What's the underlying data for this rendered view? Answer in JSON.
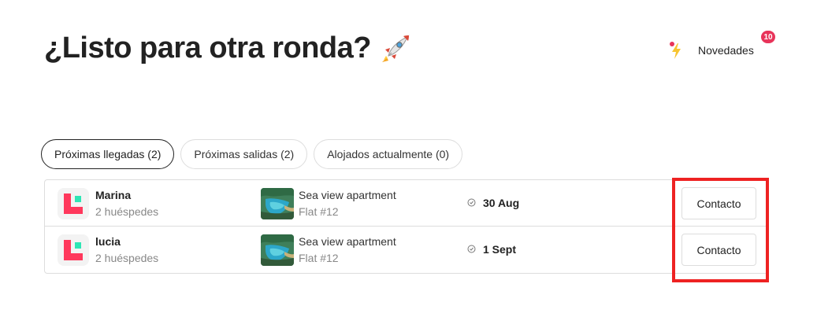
{
  "header": {
    "title": "¿Listo para otra ronda?",
    "title_icon": "rocket-icon",
    "news": {
      "label": "Novedades",
      "icon": "bolt-icon",
      "badge_count": "10"
    }
  },
  "tabs": [
    {
      "label": "Próximas llegadas (2)",
      "active": true
    },
    {
      "label": "Próximas salidas (2)",
      "active": false
    },
    {
      "label": "Alojados actualmente (0)",
      "active": false
    }
  ],
  "reservations": [
    {
      "guest_name": "Marina",
      "guests": "2 huéspedes",
      "property_name": "Sea view apartment",
      "unit": "Flat #12",
      "date": "30 Aug",
      "contact_label": "Contacto"
    },
    {
      "guest_name": "lucia",
      "guests": "2 huéspedes",
      "property_name": "Sea view apartment",
      "unit": "Flat #12",
      "date": "1 Sept",
      "contact_label": "Contacto"
    }
  ],
  "colors": {
    "badge": "#e8345a",
    "brand_pink": "#ff385c",
    "brand_green": "#2ee6b5",
    "highlight": "#ee2222"
  }
}
